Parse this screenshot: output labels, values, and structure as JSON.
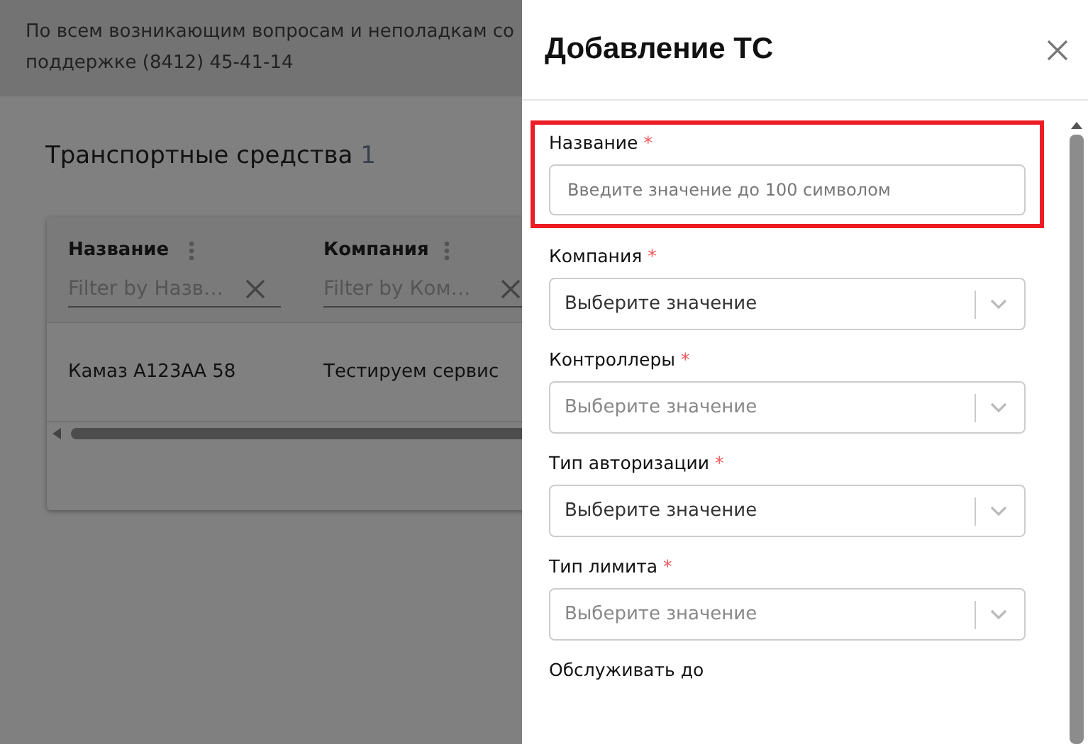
{
  "notice": {
    "lines": [
      "По всем возникающим вопросам и неполадкам со",
      "поддержке (8412) 45-41-14"
    ]
  },
  "page": {
    "title": "Транспортные средства",
    "count": "1"
  },
  "table": {
    "columns": [
      {
        "label": "Название",
        "filter_placeholder": "Filter by Назв…"
      },
      {
        "label": "Компания",
        "filter_placeholder": "Filter by Ком…"
      }
    ],
    "rows": [
      [
        "Камаз А123АА 58",
        "Тестируем сервис"
      ]
    ]
  },
  "drawer": {
    "title": "Добавление ТС",
    "fields": [
      {
        "kind": "text",
        "label": "Название",
        "mark": "*",
        "placeholder": "Введите значение до 100 символом",
        "highlighted": true
      },
      {
        "kind": "select",
        "label": "Компания",
        "mark": "*",
        "placeholder": "Выберите значение",
        "disabled": false,
        "highlighted": false
      },
      {
        "kind": "select",
        "label": "Контроллеры",
        "mark": "*",
        "placeholder": "Выберите значение",
        "disabled": true,
        "highlighted": false
      },
      {
        "kind": "select",
        "label": "Тип авторизации",
        "mark": "*",
        "placeholder": "Выберите значение",
        "disabled": false,
        "highlighted": false
      },
      {
        "kind": "select",
        "label": "Тип лимита",
        "mark": "*",
        "placeholder": "Выберите значение",
        "disabled": true,
        "highlighted": false
      },
      {
        "kind": "date",
        "label": "Обслуживать до",
        "highlighted": false
      }
    ]
  }
}
